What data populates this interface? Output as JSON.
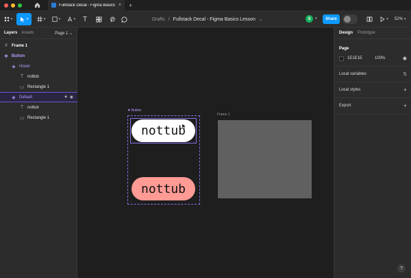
{
  "window": {
    "tab_title": "Fullstack Decal - Figma Basics Les",
    "tab_close": "×",
    "new_tab": "+"
  },
  "toolbar": {
    "breadcrumb_drafts": "Drafts",
    "breadcrumb_sep": "/",
    "file_name": "Fullstack Decal - Figma Basics Lesson",
    "file_caret": "⌄",
    "avatar_initial": "S",
    "share_label": "Share",
    "zoom_level": "52%"
  },
  "left_panel": {
    "tabs": [
      "Layers",
      "Assets"
    ],
    "page_label": "Page 1 ⌄",
    "layers": [
      {
        "label": "Frame 1",
        "icon": "#",
        "bold": true
      },
      {
        "label": "Button",
        "icon": "❖",
        "bold": true,
        "purple": true
      },
      {
        "label": "Hover",
        "icon": "◈",
        "purple": true
      },
      {
        "label": "nottub",
        "icon": "T"
      },
      {
        "label": "Rectangle 1",
        "icon": "▭"
      },
      {
        "label": "Default",
        "icon": "◈",
        "purple": true,
        "selected": true
      },
      {
        "label": "nottub",
        "icon": "T"
      },
      {
        "label": "Rectangle 1",
        "icon": "▭"
      }
    ]
  },
  "canvas": {
    "component_label": "❖ Button",
    "pill_default_text": "nottub",
    "pill_hover_text": "nottub",
    "frame_label": "Frame 1"
  },
  "right_panel": {
    "tabs": [
      "Design",
      "Prototype"
    ],
    "page_title": "Page",
    "bg_hex": "1E1E1E",
    "bg_opacity": "100%",
    "local_variables": "Local variables",
    "local_styles": "Local styles",
    "export": "Export"
  },
  "help": "?",
  "colors": {
    "accent": "#0d99ff",
    "component": "#8a6ee6",
    "pill_hover": "#ff9a94",
    "frame_fill": "#606060",
    "avatar": "#14ae5c"
  }
}
